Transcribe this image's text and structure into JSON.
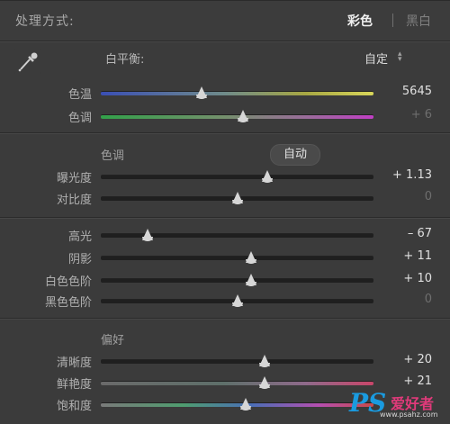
{
  "header": {
    "title": "处理方式:",
    "mode_color": "彩色",
    "mode_bw": "黑白"
  },
  "white_balance": {
    "label": "白平衡:",
    "value": "自定",
    "rows": [
      {
        "label": "色温",
        "value": "5645",
        "position": 0.37,
        "track": "temp",
        "dim": false
      },
      {
        "label": "色调",
        "value": "+ 6",
        "position": 0.52,
        "track": "tint",
        "dim": true
      }
    ]
  },
  "tone": {
    "section_label": "色调",
    "auto_label": "自动",
    "rows": [
      {
        "label": "曝光度",
        "value": "+ 1.13",
        "position": 0.61,
        "track": "plain",
        "dim": false
      },
      {
        "label": "对比度",
        "value": "0",
        "position": 0.5,
        "track": "plain",
        "dim": true
      },
      {
        "label": "高光",
        "value": "– 67",
        "position": 0.17,
        "track": "plain",
        "dim": false
      },
      {
        "label": "阴影",
        "value": "+ 11",
        "position": 0.55,
        "track": "plain",
        "dim": false
      },
      {
        "label": "白色色阶",
        "value": "+ 10",
        "position": 0.55,
        "track": "plain",
        "dim": false
      },
      {
        "label": "黑色色阶",
        "value": "0",
        "position": 0.5,
        "track": "plain",
        "dim": true
      }
    ]
  },
  "presence": {
    "section_label": "偏好",
    "rows": [
      {
        "label": "清晰度",
        "value": "+ 20",
        "position": 0.6,
        "track": "plain",
        "dim": false
      },
      {
        "label": "鲜艳度",
        "value": "+ 21",
        "position": 0.6,
        "track": "vib",
        "dim": false
      },
      {
        "label": "饱和度",
        "value": "",
        "position": 0.53,
        "track": "sat",
        "dim": false
      }
    ]
  },
  "watermark": {
    "ps": "PS",
    "cn": "爱好者",
    "url": "www.psahz.com"
  },
  "colors": {
    "panel_bg": "#3b3b3b",
    "thumb": "#d6d6d6",
    "value_text": "#e0e0e0",
    "dim_text": "#6e6e6e"
  }
}
